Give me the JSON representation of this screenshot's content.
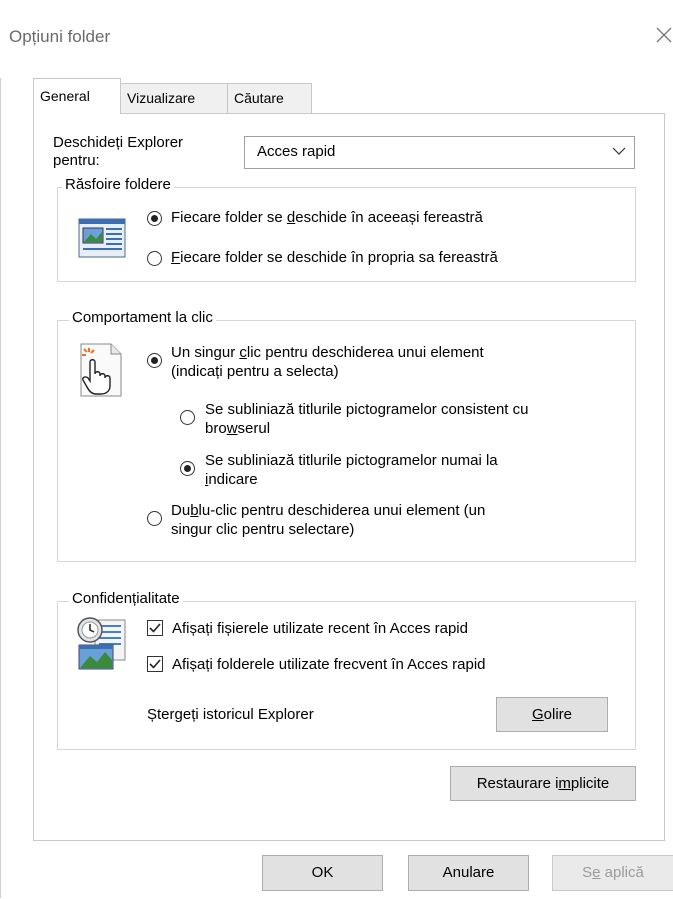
{
  "window": {
    "title": "Opțiuni folder"
  },
  "tabs": [
    "General",
    "Vizualizare",
    "Căutare"
  ],
  "open_explorer": {
    "label_line1": "Deschideți Explorer",
    "label_line2": "pentru:",
    "value": "Acces rapid"
  },
  "browse": {
    "legend": "Răsfoire foldere",
    "opt1_pre": "Fiecare folder se ",
    "opt1_u": "d",
    "opt1_post": "eschide în aceeași fereastră",
    "opt2_u": "F",
    "opt2_post": "iecare folder se deschide în propria sa fereastră"
  },
  "click": {
    "legend": "Comportament la clic",
    "single_pre": "Un singur ",
    "single_u": "c",
    "single_post": "lic pentru deschiderea unui element",
    "single_line2": "(indicați pentru a selecta)",
    "sub1_line1": "Se subliniază titlurile pictogramelor consistent cu",
    "sub1_line2_pre": "bro",
    "sub1_line2_u": "w",
    "sub1_line2_post": "serul",
    "sub2_line1": "Se subliniază titlurile pictogramelor numai la",
    "sub2_line2_u": "i",
    "sub2_line2_post": "ndicare",
    "double_pre": "Du",
    "double_u": "b",
    "double_post": "lu-clic pentru deschiderea unui element (un",
    "double_line2": "singur clic pentru selectare)"
  },
  "privacy": {
    "legend": "Confidențialitate",
    "recent_files": "Afișați fișierele utilizate recent în Acces rapid",
    "frequent_folders": "Afișați folderele utilizate frecvent în Acces rapid",
    "clear_label": "Ștergeți istoricul Explorer",
    "clear_button_u": "G",
    "clear_button_post": "olire"
  },
  "restore": {
    "pre": "Restaurare i",
    "u": "m",
    "post": "plicite"
  },
  "footer": {
    "ok": "OK",
    "cancel": "Anulare",
    "apply_pre": "S",
    "apply_u": "e",
    "apply_post": " aplică"
  }
}
